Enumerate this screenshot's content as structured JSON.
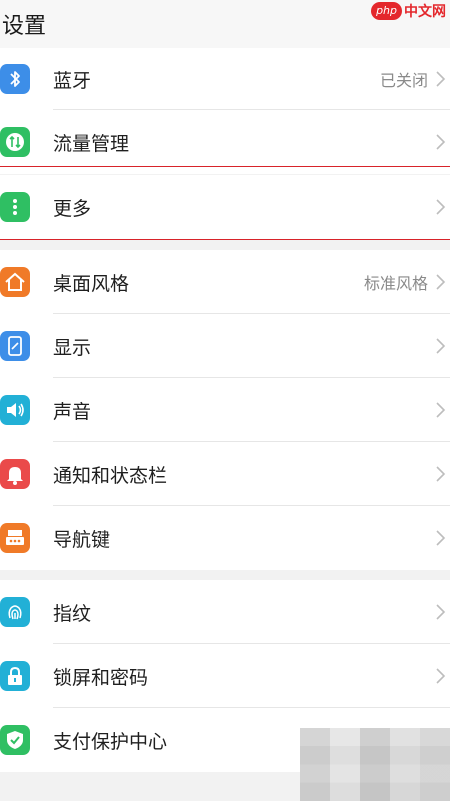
{
  "header": {
    "title": "设置",
    "watermark_badge": "php",
    "watermark_text": "中文网"
  },
  "groups": [
    {
      "items": [
        {
          "label": "蓝牙",
          "value": "已关闭",
          "icon": "bluetooth-icon",
          "color": "#3d8ee8"
        },
        {
          "label": "流量管理",
          "value": "",
          "icon": "traffic-icon",
          "color": "#2fbf63"
        },
        {
          "label": "更多",
          "value": "",
          "icon": "more-icon",
          "color": "#2fbf63"
        }
      ]
    },
    {
      "items": [
        {
          "label": "桌面风格",
          "value": "标准风格",
          "icon": "home-icon",
          "color": "#f07a28"
        },
        {
          "label": "显示",
          "value": "",
          "icon": "display-icon",
          "color": "#3d8ee8"
        },
        {
          "label": "声音",
          "value": "",
          "icon": "sound-icon",
          "color": "#22b0d6"
        },
        {
          "label": "通知和状态栏",
          "value": "",
          "icon": "notification-icon",
          "color": "#ea4a4a"
        },
        {
          "label": "导航键",
          "value": "",
          "icon": "navigation-keys-icon",
          "color": "#f07a28"
        }
      ]
    },
    {
      "items": [
        {
          "label": "指纹",
          "value": "",
          "icon": "fingerprint-icon",
          "color": "#22b0d6"
        },
        {
          "label": "锁屏和密码",
          "value": "",
          "icon": "lock-icon",
          "color": "#22b0d6"
        },
        {
          "label": "支付保护中心",
          "value": "",
          "icon": "shield-icon",
          "color": "#2fbf63"
        }
      ]
    }
  ],
  "colors": {
    "accent_red_line": "#d8232a",
    "chevron": "#bdbdbd"
  }
}
